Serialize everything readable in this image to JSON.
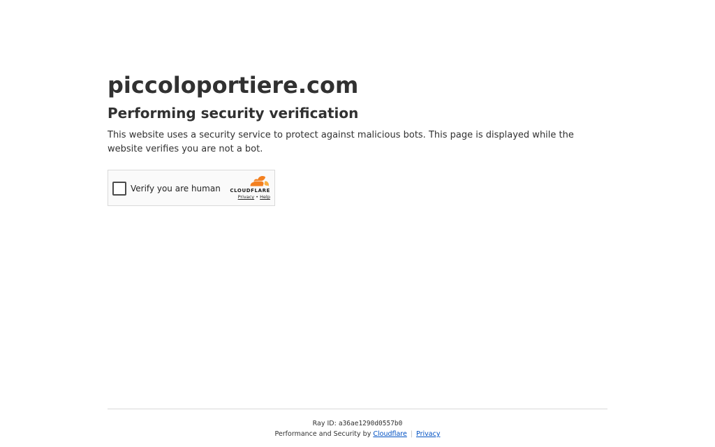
{
  "header": {
    "domain": "piccoloportiere.com",
    "subtitle": "Performing security verification",
    "description": "This website uses a security service to protect against malicious bots. This page is displayed while the website verifies you are not a bot."
  },
  "widget": {
    "checkbox_label": "Verify you are human",
    "brand": "CLOUDFLARE",
    "privacy_link": "Privacy",
    "link_separator": "•",
    "help_link": "Help"
  },
  "footer": {
    "ray_prefix": "Ray ID: ",
    "ray_id": "a36ae1290d0557b0",
    "performance_text": "Performance and Security by ",
    "cloudflare_link": "Cloudflare",
    "separator": "|",
    "privacy_link": "Privacy"
  },
  "colors": {
    "text": "#313131",
    "link": "#0051c3",
    "cloud_orange": "#f38020",
    "cloud_light": "#faae40"
  }
}
